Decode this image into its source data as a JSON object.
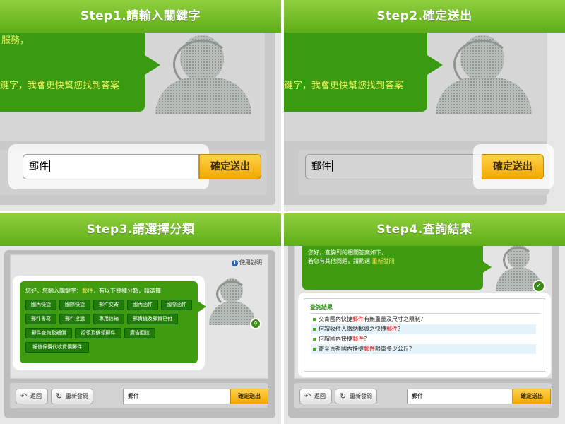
{
  "steps": [
    {
      "title": "Step1.請輸入關鍵字"
    },
    {
      "title": "Step2.確定送出"
    },
    {
      "title": "Step3.請選擇分類"
    },
    {
      "title": "Step4.查詢結果"
    }
  ],
  "top_bubble": {
    "partial_top": "服務，",
    "line1": "鍵字，我會更快幫您找到答案",
    "line2": "鍵字，我會更快幫您找到答案"
  },
  "search": {
    "value": "郵件",
    "submit_label": "確定送出"
  },
  "step3": {
    "help_label": "使用說明",
    "intro_prefix": "您好，您輸入關鍵字：",
    "intro_keyword": "郵件",
    "intro_suffix": "，有以下幾種分類，請選擇",
    "categories": [
      "國內快捷",
      "國際快捷",
      "郵件交寄",
      "國內函件",
      "國際函件",
      "郵件書寫",
      "郵件投遞",
      "專用信箱",
      "郵資機及郵資已付",
      "郵件查詢及補償",
      "招領及候領郵件",
      "廣告回信",
      "報值保價代收貨價郵件"
    ],
    "back_label": "返回",
    "restart_label": "重新發問",
    "input_value": "郵件",
    "submit_label": "確定送出"
  },
  "step4": {
    "bubble_line1": "您好，查詢到的相關答案如下，",
    "bubble_line2_prefix": "若您有其他問題，請點選",
    "bubble_link": "重新發問",
    "result_title": "查詢結果",
    "results": [
      {
        "pre": "交寄國內快捷",
        "kw": "郵件",
        "post": "有無重量及尺寸之限制？"
      },
      {
        "pre": "何謂收件人繳納郵資之快捷",
        "kw": "郵件",
        "post": "？"
      },
      {
        "pre": "何謂國內快捷",
        "kw": "郵件",
        "post": "？"
      },
      {
        "pre": "寄至馬祖國內快捷",
        "kw": "郵件",
        "post": "限重多少公斤？"
      }
    ],
    "back_label": "返回",
    "restart_label": "重新發問",
    "input_value": "郵件",
    "submit_label": "確定送出"
  },
  "icons": {
    "back": "back-arrow-icon",
    "restart": "refresh-icon",
    "help": "info-icon",
    "search": "search-icon",
    "check": "check-icon"
  },
  "colors": {
    "header_green": "#6cb820",
    "bubble_green": "#3a9a12",
    "accent_yellow": "#f0a800",
    "keyword_red": "#e01818"
  }
}
